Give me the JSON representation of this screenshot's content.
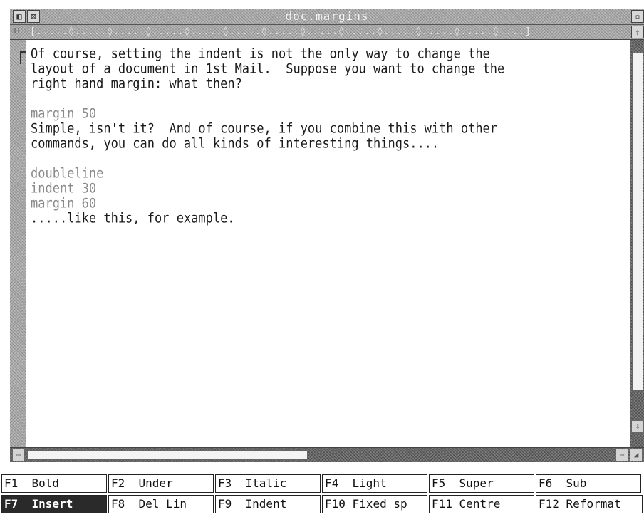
{
  "window": {
    "title": "doc.margins",
    "close_icon": "close-icon",
    "back_icon": "back-icon",
    "toggle_icon": "toggle-size-icon"
  },
  "ruler": {
    "text": "[.....◊.....◊.....◊.....◊.....◊.....◊.....◊.....◊.....◊.....◊.....◊.....◊....]",
    "icon": "ruler-icon"
  },
  "document": {
    "lines": [
      {
        "text": "Of course, setting the indent is not the only way to change the",
        "kind": "text"
      },
      {
        "text": "layout of a document in 1st Mail.  Suppose you want to change the",
        "kind": "text"
      },
      {
        "text": "right hand margin: what then?",
        "kind": "text"
      },
      {
        "text": "",
        "kind": "blank"
      },
      {
        "text": "margin 50",
        "kind": "cmd"
      },
      {
        "text": "Simple, isn't it?  And of course, if you combine this with other",
        "kind": "text"
      },
      {
        "text": "commands, you can do all kinds of interesting things....",
        "kind": "text"
      },
      {
        "text": "",
        "kind": "blank"
      },
      {
        "text": "doubleline",
        "kind": "cmd"
      },
      {
        "text": "indent 30",
        "kind": "cmd"
      },
      {
        "text": "margin 60",
        "kind": "cmd"
      },
      {
        "text": ".....like this, for example.",
        "kind": "text"
      }
    ]
  },
  "function_keys": [
    {
      "key": "F1",
      "label": "Bold",
      "active": false
    },
    {
      "key": "F2",
      "label": "Under",
      "active": false
    },
    {
      "key": "F3",
      "label": "Italic",
      "active": false
    },
    {
      "key": "F4",
      "label": "Light",
      "active": false
    },
    {
      "key": "F5",
      "label": "Super",
      "active": false
    },
    {
      "key": "F6",
      "label": "Sub",
      "active": false
    },
    {
      "key": "F7",
      "label": "Insert",
      "active": true
    },
    {
      "key": "F8",
      "label": "Del Lin",
      "active": false
    },
    {
      "key": "F9",
      "label": "Indent",
      "active": false
    },
    {
      "key": "F10",
      "label": "Fixed sp",
      "active": false
    },
    {
      "key": "F11",
      "label": "Centre",
      "active": false
    },
    {
      "key": "F12",
      "label": "Reformat",
      "active": false
    }
  ],
  "colors": {
    "window_chrome": "#b9b9b9",
    "command_text": "#8a8a8a",
    "active_key": "#2a2a2a"
  }
}
